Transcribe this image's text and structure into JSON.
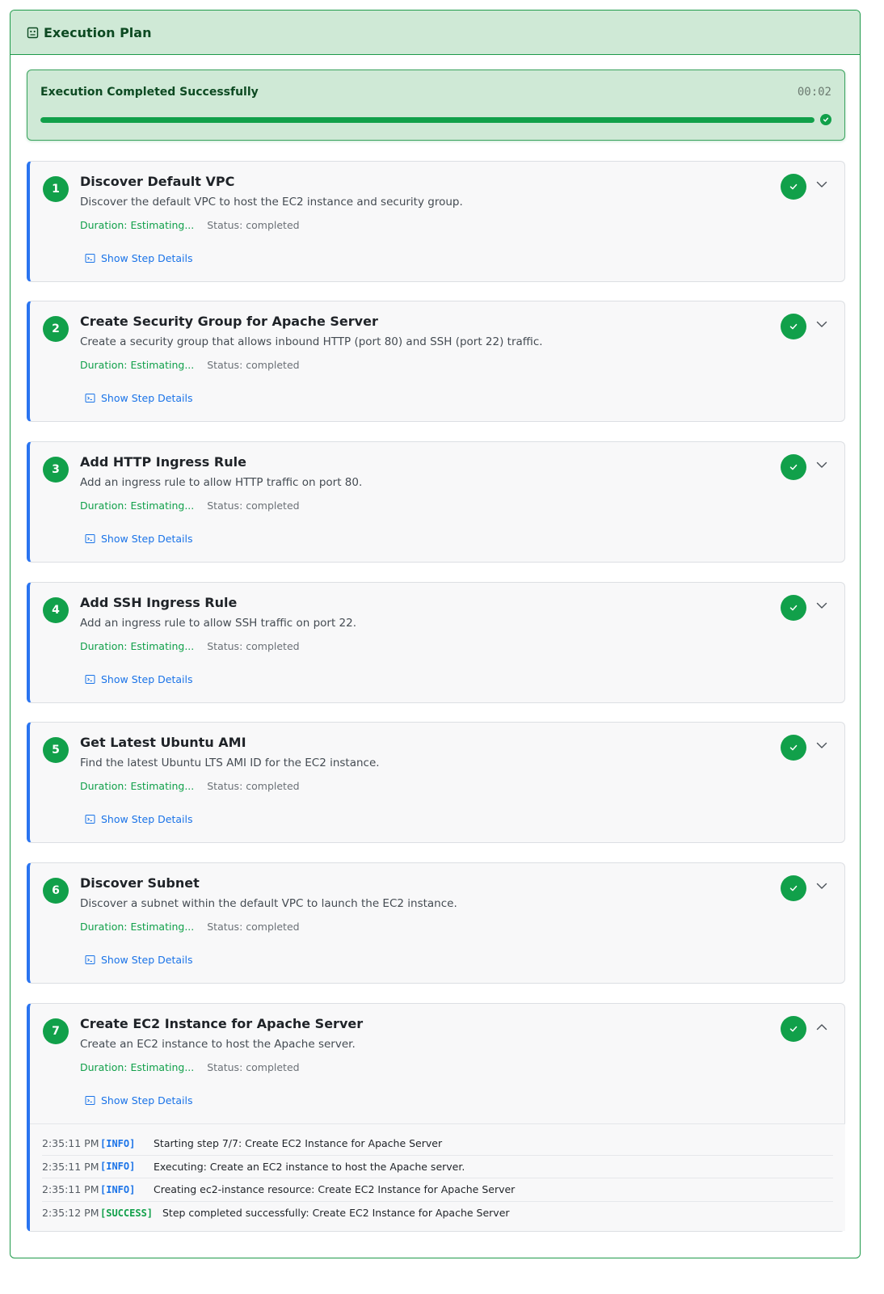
{
  "panel": {
    "title": "Execution Plan",
    "header_icon": "robot-icon"
  },
  "status": {
    "text": "Execution Completed Successfully",
    "time": "00:02",
    "progress": 1.0,
    "accent": "#11a04a"
  },
  "steps": [
    {
      "number": "1",
      "title": "Discover Default VPC",
      "description": "Discover the default VPC to host the EC2 instance and security group.",
      "duration": "Duration: Estimating...",
      "status": "Status: completed",
      "details": "Show Step Details",
      "expanded": false
    },
    {
      "number": "2",
      "title": "Create Security Group for Apache Server",
      "description": "Create a security group that allows inbound HTTP (port 80) and SSH (port 22) traffic.",
      "duration": "Duration: Estimating...",
      "status": "Status: completed",
      "details": "Show Step Details",
      "expanded": false
    },
    {
      "number": "3",
      "title": "Add HTTP Ingress Rule",
      "description": "Add an ingress rule to allow HTTP traffic on port 80.",
      "duration": "Duration: Estimating...",
      "status": "Status: completed",
      "details": "Show Step Details",
      "expanded": false
    },
    {
      "number": "4",
      "title": "Add SSH Ingress Rule",
      "description": "Add an ingress rule to allow SSH traffic on port 22.",
      "duration": "Duration: Estimating...",
      "status": "Status: completed",
      "details": "Show Step Details",
      "expanded": false
    },
    {
      "number": "5",
      "title": "Get Latest Ubuntu AMI",
      "description": "Find the latest Ubuntu LTS AMI ID for the EC2 instance.",
      "duration": "Duration: Estimating...",
      "status": "Status: completed",
      "details": "Show Step Details",
      "expanded": false
    },
    {
      "number": "6",
      "title": "Discover Subnet",
      "description": "Discover a subnet within the default VPC to launch the EC2 instance.",
      "duration": "Duration: Estimating...",
      "status": "Status: completed",
      "details": "Show Step Details",
      "expanded": false
    },
    {
      "number": "7",
      "title": "Create EC2 Instance for Apache Server",
      "description": "Create an EC2 instance to host the Apache server.",
      "duration": "Duration: Estimating...",
      "status": "Status: completed",
      "details": "Show Step Details",
      "expanded": true,
      "logs": [
        {
          "time": "2:35:11 PM",
          "level": "[INFO]",
          "message": "Starting step 7/7: Create EC2 Instance for Apache Server"
        },
        {
          "time": "2:35:11 PM",
          "level": "[INFO]",
          "message": "Executing: Create an EC2 instance to host the Apache server."
        },
        {
          "time": "2:35:11 PM",
          "level": "[INFO]",
          "message": "Creating ec2-instance resource: Create EC2 Instance for Apache Server"
        },
        {
          "time": "2:35:12 PM",
          "level": "[SUCCESS]",
          "message": "Step completed successfully: Create EC2 Instance for Apache Server"
        }
      ]
    }
  ]
}
